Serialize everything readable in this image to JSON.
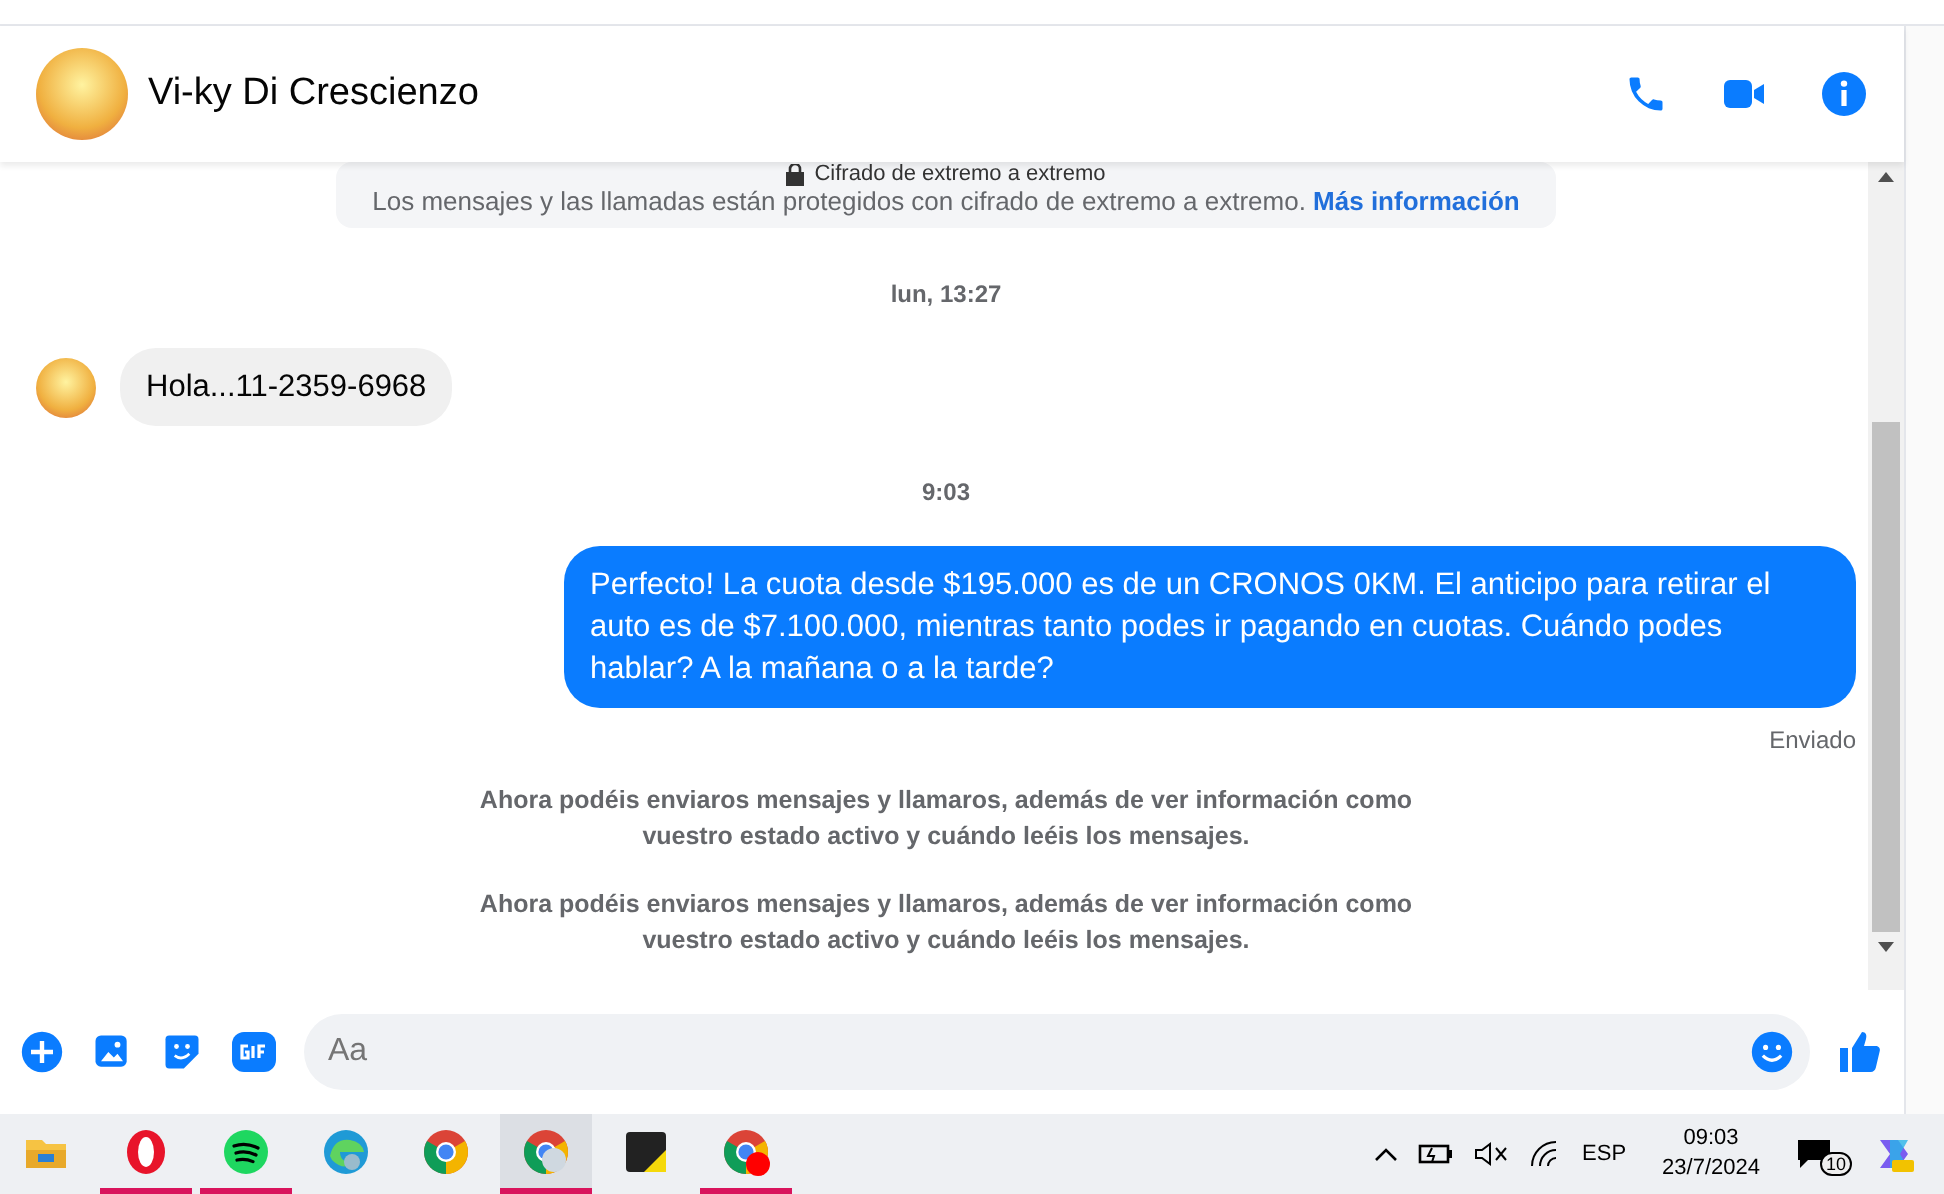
{
  "header": {
    "contact_name": "Vi-ky Di Crescienzo"
  },
  "encryption": {
    "title": "Cifrado de extremo a extremo",
    "text": "Los mensajes y las llamadas están protegidos con cifrado de extremo a extremo.",
    "link": "Más información"
  },
  "messages": [
    {
      "kind": "timestamp",
      "text": "lun, 13:27"
    },
    {
      "kind": "incoming",
      "text": "Hola...11-2359-6968"
    },
    {
      "kind": "timestamp",
      "text": "9:03"
    },
    {
      "kind": "outgoing",
      "text": "Perfecto! La cuota desde $195.000 es de un CRONOS 0KM. El anticipo para retirar el auto es de $7.100.000, mientras tanto podes ir pagando en cuotas. Cuándo podes hablar? A la mañana o a la tarde?",
      "status": "Enviado"
    },
    {
      "kind": "notice",
      "text": "Ahora podéis enviaros mensajes y llamaros, además de ver información como vuestro estado activo y cuándo leéis los mensajes."
    },
    {
      "kind": "notice",
      "text": "Ahora podéis enviaros mensajes y llamaros, además de ver información como vuestro estado activo y cuándo leéis los mensajes."
    }
  ],
  "composer": {
    "placeholder": "Aa"
  },
  "taskbar": {
    "apps": [
      {
        "kind": "folder",
        "running": false,
        "selected": false
      },
      {
        "kind": "opera",
        "running": true,
        "selected": false
      },
      {
        "kind": "spotify",
        "running": true,
        "selected": false
      },
      {
        "kind": "edge",
        "running": false,
        "selected": false
      },
      {
        "kind": "chrome",
        "running": false,
        "selected": false
      },
      {
        "kind": "chrome-profile",
        "running": true,
        "selected": true
      },
      {
        "kind": "notes",
        "running": false,
        "selected": false
      },
      {
        "kind": "chrome-dot",
        "running": true,
        "selected": false
      }
    ],
    "language": "ESP",
    "time": "09:03",
    "date": "23/7/2024",
    "notification_count": "10"
  }
}
